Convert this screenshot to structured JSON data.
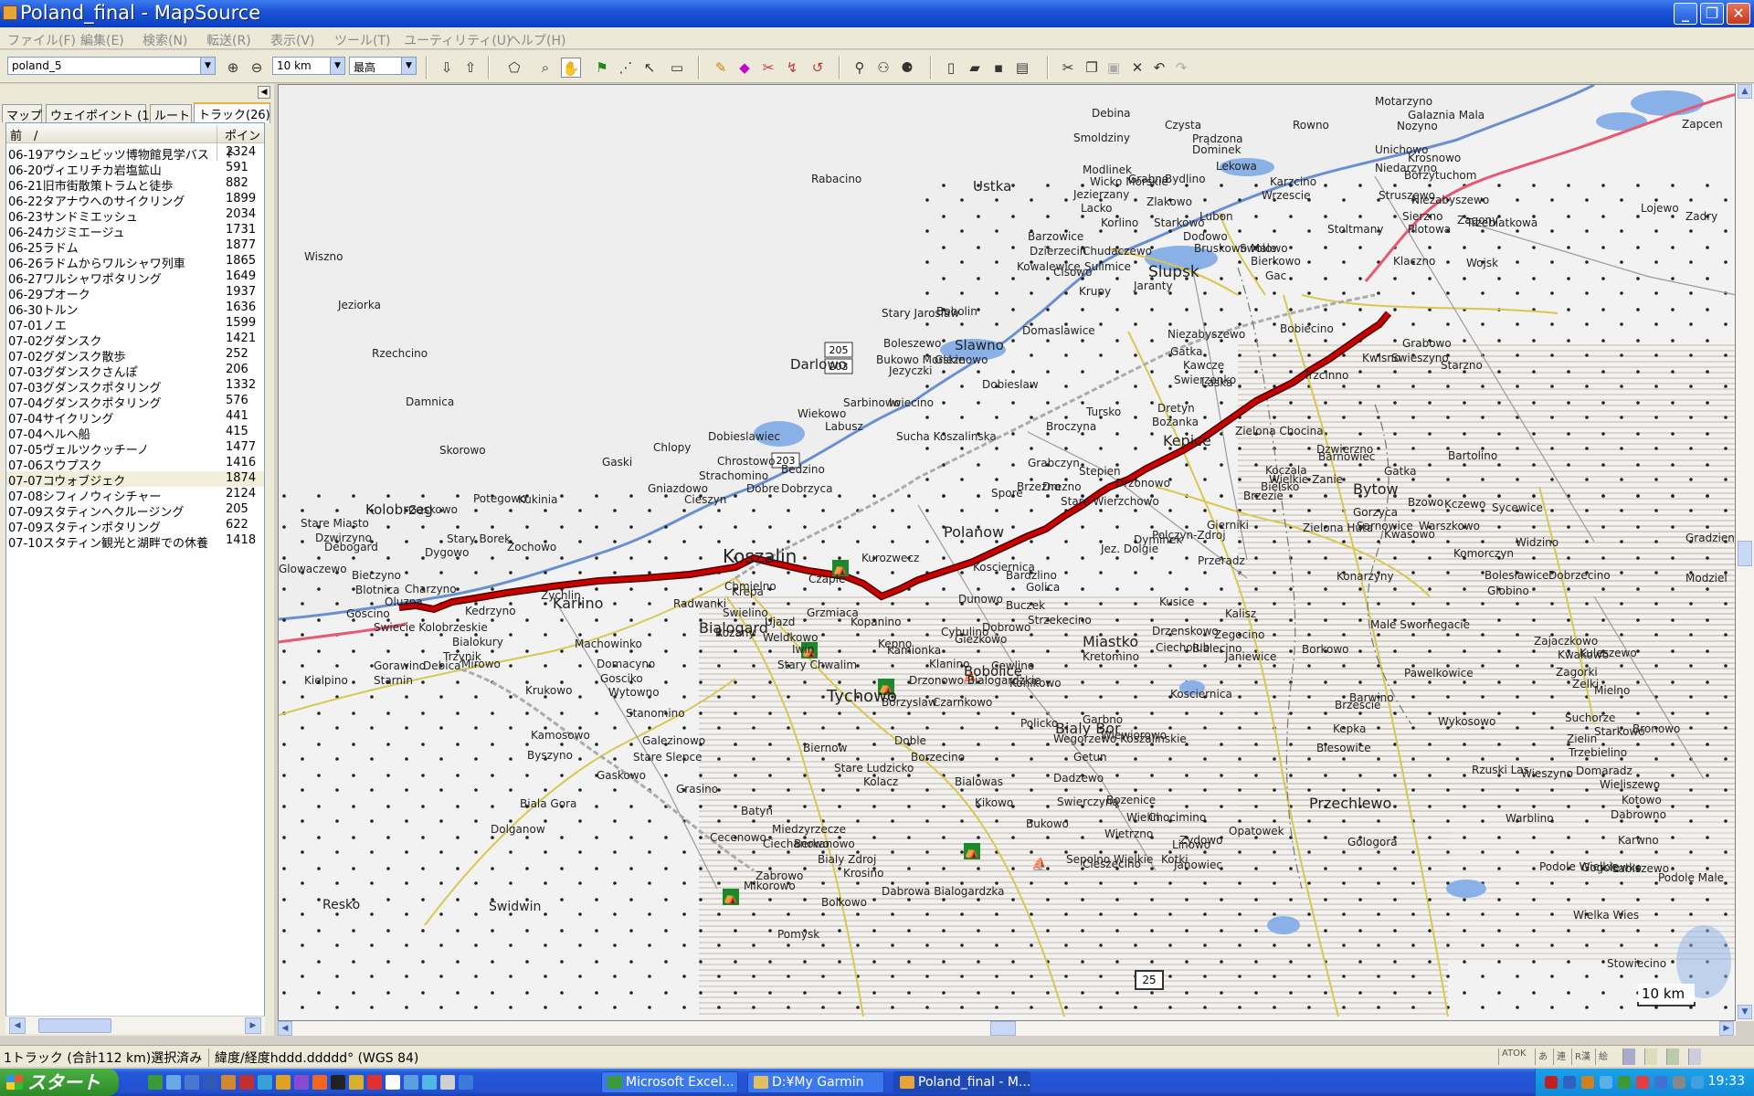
{
  "window": {
    "title": "Poland_final - MapSource",
    "minimize": "_",
    "restore": "❐",
    "close": "✕"
  },
  "menu": [
    "ファイル(F)",
    "編集(E)",
    "検索(N)",
    "転送(R)",
    "表示(V)",
    "ツール(T)",
    "ユーティリティ(U)",
    "ヘルプ(H)"
  ],
  "toolbar": {
    "map_product": "poland_5",
    "zoom_scale": "10 km",
    "detail_level": "最高"
  },
  "sidebar": {
    "tabs": [
      "マップ",
      "ウェイポイント (1)",
      "ルート",
      "トラック(26)"
    ],
    "active_tab": 3,
    "columns": {
      "name": "前　/",
      "points": "ポイント"
    },
    "tracks": [
      {
        "name": "06-19アウシュビッツ博物館見学バス",
        "points": "2324"
      },
      {
        "name": "06-20ヴィエリチカ岩塩鉱山",
        "points": "591"
      },
      {
        "name": "06-21旧市街散策トラムと徒歩",
        "points": "882"
      },
      {
        "name": "06-22タアナウへのサイクリング",
        "points": "1899"
      },
      {
        "name": "06-23サンドミエッシュ",
        "points": "2034"
      },
      {
        "name": "06-24カジミエージュ",
        "points": "1731"
      },
      {
        "name": "06-25ラドム",
        "points": "1877"
      },
      {
        "name": "06-26ラドムからワルシャワ列車",
        "points": "1865"
      },
      {
        "name": "06-27ワルシャワポタリング",
        "points": "1649"
      },
      {
        "name": "06-29プオーク",
        "points": "1937"
      },
      {
        "name": "06-30トルン",
        "points": "1636"
      },
      {
        "name": "07-01ノエ",
        "points": "1599"
      },
      {
        "name": "07-02グダンスク",
        "points": "1421"
      },
      {
        "name": "07-02グダンスク散歩",
        "points": "252"
      },
      {
        "name": "07-03グダンスクさんぽ",
        "points": "206"
      },
      {
        "name": "07-03グダンスクポタリング",
        "points": "1332"
      },
      {
        "name": "07-04グダンスクポタリング",
        "points": "576"
      },
      {
        "name": "07-04サイクリング",
        "points": "441"
      },
      {
        "name": "07-04ヘルへ船",
        "points": "415"
      },
      {
        "name": "07-05ヴェルツクッチーノ",
        "points": "1477"
      },
      {
        "name": "07-06スウプスク",
        "points": "1416"
      },
      {
        "name": "07-07コウォブジェク",
        "points": "1874"
      },
      {
        "name": "07-08シフィノウィシチャー",
        "points": "2124"
      },
      {
        "name": "07-09スタティンヘクルージング",
        "points": "205"
      },
      {
        "name": "07-09スタティンポタリング",
        "points": "622"
      },
      {
        "name": "07-10スタティン観光と湖畔での休養",
        "points": "1418"
      }
    ],
    "selected_index": 21
  },
  "map": {
    "scale_label": "10 km",
    "colors": {
      "sea": "#6a8fd0",
      "land": "#f2f2f2",
      "track": "#cc0000",
      "track_outline": "#4a0000",
      "road_yellow": "#d8c850",
      "forest_hatch": "#b8a088"
    },
    "labels": [
      {
        "text": "Koszalin",
        "big": true
      },
      {
        "text": "Slupsk",
        "big": true
      },
      {
        "text": "Kolobrzeg"
      },
      {
        "text": "Darlowo"
      },
      {
        "text": "Ustka"
      },
      {
        "text": "Bialogard"
      },
      {
        "text": "Karlino"
      },
      {
        "text": "Tychowo"
      },
      {
        "text": "Bobolice"
      },
      {
        "text": "Polanow"
      },
      {
        "text": "Miastko"
      },
      {
        "text": "Bytow"
      },
      {
        "text": "Bialy Bor"
      },
      {
        "text": "Kepice"
      },
      {
        "text": "Slawno"
      },
      {
        "text": "Przechlewo"
      },
      {
        "text": "Swidwin"
      },
      {
        "text": "Resko"
      },
      {
        "text": "Debina"
      },
      {
        "text": "Czysta"
      },
      {
        "text": "Rowno"
      },
      {
        "text": "Dominek"
      },
      {
        "text": "Lekowa"
      },
      {
        "text": "Karzcino"
      },
      {
        "text": "Wrzescie"
      },
      {
        "text": "Grabno"
      },
      {
        "text": "Bydlino"
      },
      {
        "text": "Modlinek"
      },
      {
        "text": "Wicko Morskie"
      },
      {
        "text": "Jezierzany"
      },
      {
        "text": "Lacko"
      },
      {
        "text": "Zlakowo"
      },
      {
        "text": "Korlino"
      },
      {
        "text": "Starkowo"
      },
      {
        "text": "Dodowo"
      },
      {
        "text": "Bruskowo Male"
      },
      {
        "text": "Swolowo"
      },
      {
        "text": "Bierkowo"
      },
      {
        "text": "Gac"
      },
      {
        "text": "Barzowice"
      },
      {
        "text": "Dzierzecin"
      },
      {
        "text": "Chudaczewo"
      },
      {
        "text": "Sulimice"
      },
      {
        "text": "Kowalewice"
      },
      {
        "text": "Cisowo"
      },
      {
        "text": "Krupy"
      },
      {
        "text": "Stary Jaroslaw"
      },
      {
        "text": "Bobolin"
      },
      {
        "text": "Domaslawice"
      },
      {
        "text": "Boleszewo"
      },
      {
        "text": "Bukowo Morskie"
      },
      {
        "text": "Gleznowo"
      },
      {
        "text": "Jezyczki"
      },
      {
        "text": "Dobieslaw"
      },
      {
        "text": "Sarbinowo"
      },
      {
        "text": "Iwiecino"
      },
      {
        "text": "Wiekowo"
      },
      {
        "text": "Labusz"
      },
      {
        "text": "Sucha Koszalinska"
      },
      {
        "text": "Dobieslawiec"
      },
      {
        "text": "Chlopy"
      },
      {
        "text": "Gaski"
      },
      {
        "text": "Chrostowo"
      },
      {
        "text": "Bedzino"
      },
      {
        "text": "Dobre"
      },
      {
        "text": "Dobrzyca"
      },
      {
        "text": "Gniazdowo"
      },
      {
        "text": "Cieszyn"
      },
      {
        "text": "Kukinia"
      },
      {
        "text": "Strachomino"
      },
      {
        "text": "Gaskowo"
      },
      {
        "text": "Stare Miasto"
      },
      {
        "text": "Dzwirzyno"
      },
      {
        "text": "Stary Borek"
      },
      {
        "text": "Dygowo"
      },
      {
        "text": "Debogard"
      },
      {
        "text": "Glowaczewo"
      },
      {
        "text": "Bieczyno"
      },
      {
        "text": "Blotnica"
      },
      {
        "text": "Charzyno"
      },
      {
        "text": "Oluzna"
      },
      {
        "text": "Kedrzyno"
      },
      {
        "text": "Goscino"
      },
      {
        "text": "Swiecie Kolobrzeskie"
      },
      {
        "text": "Bialokury"
      },
      {
        "text": "Trzynik"
      },
      {
        "text": "Gorawino"
      },
      {
        "text": "Debica"
      },
      {
        "text": "Mirowo"
      },
      {
        "text": "Kielpino"
      },
      {
        "text": "Starnin"
      },
      {
        "text": "Domacyno"
      },
      {
        "text": "Gosciko"
      },
      {
        "text": "Krukowo"
      },
      {
        "text": "Kamosowo"
      },
      {
        "text": "Stanomino"
      },
      {
        "text": "Byszyno"
      },
      {
        "text": "Stare Slepce"
      },
      {
        "text": "Gaskowo"
      },
      {
        "text": "Biala Gora"
      },
      {
        "text": "Dolganow"
      },
      {
        "text": "Batyn"
      },
      {
        "text": "Miedzyrzecze"
      },
      {
        "text": "Ciechanowo"
      },
      {
        "text": "Zabrowo"
      },
      {
        "text": "Berkanowo"
      },
      {
        "text": "Bialy Zdroj"
      },
      {
        "text": "Krosino"
      },
      {
        "text": "Dabrowa Bialogardzka"
      },
      {
        "text": "Bolkowo"
      },
      {
        "text": "Biernow"
      },
      {
        "text": "Stare Ludzicko"
      },
      {
        "text": "Kolacz"
      },
      {
        "text": "Doble"
      },
      {
        "text": "Borzecino"
      },
      {
        "text": "Bialowas"
      },
      {
        "text": "Kikowo"
      },
      {
        "text": "Borzyslaw"
      },
      {
        "text": "Czarnkowo"
      },
      {
        "text": "Drzonowo Bialogardzkie"
      },
      {
        "text": "Kamionka"
      },
      {
        "text": "Grzmiaca"
      },
      {
        "text": "Iwin"
      },
      {
        "text": "Stary Chwalim"
      },
      {
        "text": "Weldkowo"
      },
      {
        "text": "Ujazd"
      },
      {
        "text": "Chmielno"
      },
      {
        "text": "Rozany"
      },
      {
        "text": "Radwanki"
      },
      {
        "text": "Swielino"
      },
      {
        "text": "Krepa"
      },
      {
        "text": "Czaple"
      },
      {
        "text": "Kurozwecz"
      },
      {
        "text": "Kopanino"
      },
      {
        "text": "Kepno"
      },
      {
        "text": "Klanino"
      },
      {
        "text": "Cybulino"
      },
      {
        "text": "Dobrowo"
      },
      {
        "text": "Buczek"
      },
      {
        "text": "Kosciernica"
      },
      {
        "text": "Bardzlino"
      },
      {
        "text": "Golica"
      },
      {
        "text": "Strzekecino"
      },
      {
        "text": "Dunowo"
      },
      {
        "text": "Giezkowo"
      },
      {
        "text": "Cewlino"
      },
      {
        "text": "Konikowo"
      },
      {
        "text": "Kretomino"
      },
      {
        "text": "Policko"
      },
      {
        "text": "Wegorzewo Koszalinskie"
      },
      {
        "text": "Wiewiorowo"
      },
      {
        "text": "Kosciernica"
      },
      {
        "text": "Garbno"
      },
      {
        "text": "Getun"
      },
      {
        "text": "Dadzewo"
      },
      {
        "text": "Swierczyna"
      },
      {
        "text": "Bukowo"
      },
      {
        "text": "Bozenice"
      },
      {
        "text": "Wielin"
      },
      {
        "text": "Wietrzno"
      },
      {
        "text": "Chocimino"
      },
      {
        "text": "Zydowo"
      },
      {
        "text": "Gologora"
      },
      {
        "text": "Opatowek"
      },
      {
        "text": "Janowiec"
      },
      {
        "text": "Cieszecino"
      },
      {
        "text": "Sepolno Wielkie"
      },
      {
        "text": "Kotki"
      },
      {
        "text": "Linowo"
      },
      {
        "text": "Grabczyn"
      },
      {
        "text": "Drezno"
      },
      {
        "text": "Stare Wierzchowo"
      },
      {
        "text": "Brzezno"
      },
      {
        "text": "Spore"
      },
      {
        "text": "Stepien"
      },
      {
        "text": "Drzonowo"
      },
      {
        "text": "Brzezie"
      },
      {
        "text": "Gierniki"
      },
      {
        "text": "Dyminek"
      },
      {
        "text": "Jez. Dolgie"
      },
      {
        "text": "Przeradz"
      },
      {
        "text": "Polczyn-Zdroj"
      },
      {
        "text": "Kalisz"
      },
      {
        "text": "Kusice"
      },
      {
        "text": "Zegocino"
      },
      {
        "text": "Bialecino"
      },
      {
        "text": "Drzenskowo"
      },
      {
        "text": "Borkowo"
      },
      {
        "text": "Janiewice"
      },
      {
        "text": "Brzescie"
      },
      {
        "text": "Barwino"
      },
      {
        "text": "Kepka"
      },
      {
        "text": "Biesowice"
      },
      {
        "text": "Ciecholub"
      },
      {
        "text": "Broczyna"
      },
      {
        "text": "Tursko"
      },
      {
        "text": "Dretyn"
      },
      {
        "text": "Bozanka"
      },
      {
        "text": "Swierzenko"
      },
      {
        "text": "Kawcze"
      },
      {
        "text": "Gatka"
      },
      {
        "text": "Bobiecino"
      },
      {
        "text": "Trzcinno"
      },
      {
        "text": "Kwisno"
      },
      {
        "text": "Grabowo"
      },
      {
        "text": "Swieszyno"
      },
      {
        "text": "Starzno"
      },
      {
        "text": "Dzwierzno"
      },
      {
        "text": "Barnowiec"
      },
      {
        "text": "Koczala"
      },
      {
        "text": "Bielsko"
      },
      {
        "text": "Gatka"
      },
      {
        "text": "Bartolino"
      },
      {
        "text": "Gorzyca"
      },
      {
        "text": "Sarnowice"
      },
      {
        "text": "Kwasowo"
      },
      {
        "text": "Warszkowo"
      },
      {
        "text": "Bzowo"
      },
      {
        "text": "Kczewo"
      },
      {
        "text": "Komorczyn"
      },
      {
        "text": "Sycewice"
      },
      {
        "text": "Widzino"
      },
      {
        "text": "Bolesławice"
      },
      {
        "text": "Globino"
      },
      {
        "text": "Dobrzecino"
      },
      {
        "text": "Zajaczkowo"
      },
      {
        "text": "Kwakowo"
      },
      {
        "text": "Kuleszewo"
      },
      {
        "text": "Zagorki"
      },
      {
        "text": "Zelki"
      },
      {
        "text": "Mielno"
      },
      {
        "text": "Suchorze"
      },
      {
        "text": "Starkowo"
      },
      {
        "text": "Bronowo"
      },
      {
        "text": "Zielin"
      },
      {
        "text": "Trzebielino"
      },
      {
        "text": "Wieszyno"
      },
      {
        "text": "Domaradz"
      },
      {
        "text": "Wieliszewo"
      },
      {
        "text": "Dabrowno"
      },
      {
        "text": "Karwno"
      },
      {
        "text": "Labiszewo"
      },
      {
        "text": "Podole Male"
      },
      {
        "text": "Gogolewko"
      },
      {
        "text": "Kotowo"
      },
      {
        "text": "Motarzyno"
      },
      {
        "text": "Nozyno"
      },
      {
        "text": "Galaznia Mala"
      },
      {
        "text": "Unichowo"
      },
      {
        "text": "Krosnowo"
      },
      {
        "text": "Niedarzyno"
      },
      {
        "text": "Borzytuchom"
      },
      {
        "text": "Struszewo"
      },
      {
        "text": "Niezabyszewo"
      },
      {
        "text": "Sierzno"
      },
      {
        "text": "Zagony"
      },
      {
        "text": "Plotowa"
      },
      {
        "text": "Trzebiatkowa"
      },
      {
        "text": "Klaczno"
      },
      {
        "text": "Wojsk"
      },
      {
        "text": "Smoldziny"
      },
      {
        "text": "Prądzona"
      },
      {
        "text": "Lubon"
      },
      {
        "text": "Stoltmany"
      },
      {
        "text": "Zapcen"
      },
      {
        "text": "Zadry"
      },
      {
        "text": "Gradzien"
      },
      {
        "text": "Modziel"
      },
      {
        "text": "Jaranty"
      },
      {
        "text": "Niezabyszewo"
      },
      {
        "text": "Laska"
      },
      {
        "text": "Zielona Chocina"
      },
      {
        "text": "Wielkie Zanie"
      },
      {
        "text": "Zielona Huta"
      },
      {
        "text": "Konarzyny"
      },
      {
        "text": "Male Swornegacie"
      },
      {
        "text": "Pawelkowice"
      },
      {
        "text": "Wykosowo"
      },
      {
        "text": "Rzuski Las"
      },
      {
        "text": "Warblino"
      },
      {
        "text": "Podole Wielkie"
      },
      {
        "text": "Wielka Wies"
      },
      {
        "text": "Stowiecino"
      },
      {
        "text": "Lojewo"
      },
      {
        "text": "Wiszno"
      },
      {
        "text": "Jeziorka"
      },
      {
        "text": "Rzechcino"
      },
      {
        "text": "Damnica"
      },
      {
        "text": "Skorowo"
      },
      {
        "text": "Potegowo"
      },
      {
        "text": "Zochowo"
      },
      {
        "text": "Zychlin"
      },
      {
        "text": "Machowinko"
      },
      {
        "text": "Wytowno"
      },
      {
        "text": "Galezinowo"
      },
      {
        "text": "Grasino"
      },
      {
        "text": "Cecenowo"
      },
      {
        "text": "Mikorowo"
      },
      {
        "text": "Pomysk"
      },
      {
        "text": "Rabacino"
      }
    ],
    "road_shields": [
      "205",
      "203",
      "203",
      "25"
    ]
  },
  "status": {
    "selection": "1トラック (合計112 km)選択済み",
    "coord_format": "緯度/経度hddd.ddddd°  (WGS 84)",
    "ime": [
      "ATOK",
      "あ",
      "連",
      "R漢",
      "絵"
    ]
  },
  "taskbar": {
    "start": "スタート",
    "tasks": [
      "Microsoft Excel...",
      "D:¥My Garmin",
      "Poland_final - M..."
    ],
    "clock": "19:33"
  }
}
